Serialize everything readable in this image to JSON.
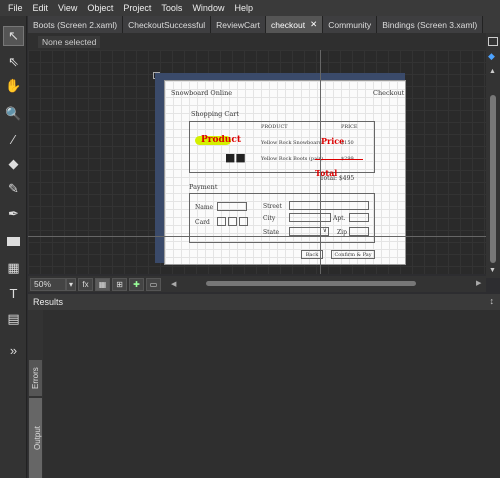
{
  "menu": [
    "File",
    "Edit",
    "View",
    "Object",
    "Project",
    "Tools",
    "Window",
    "Help"
  ],
  "tabs": [
    {
      "label": "Boots (Screen 2.xaml)",
      "active": false
    },
    {
      "label": "CheckoutSuccessful",
      "active": false
    },
    {
      "label": "ReviewCart",
      "active": false
    },
    {
      "label": "checkout",
      "active": true
    },
    {
      "label": "Community",
      "active": false
    },
    {
      "label": "Bindings (Screen 3.xaml)",
      "active": false
    }
  ],
  "selection_status": "None selected",
  "artboard": {
    "title": "Snowboard Online",
    "right_title": "Checkout",
    "cart_heading": "Shopping Cart",
    "col_product": "PRODUCT",
    "col_price": "PRICE",
    "row1": "Yellow Rock Snowboard",
    "row1_price": "$150",
    "row2": "Yellow Rock Boots (pair)",
    "row2_price": "$299",
    "total": "Total: $495",
    "annot_product": "Product",
    "annot_price": "Price",
    "annot_total": "Total",
    "payment_heading": "Payment",
    "name_label": "Name",
    "card_label": "Card",
    "street_label": "Street",
    "city_label": "City",
    "apt_label": "Apt.",
    "state_label": "State",
    "zip_label": "Zip",
    "back_label": "Back",
    "confirm_label": "Confirm & Pay"
  },
  "zoom": "50%",
  "results_title": "Results",
  "side_tabs": [
    "Errors",
    "Output"
  ]
}
